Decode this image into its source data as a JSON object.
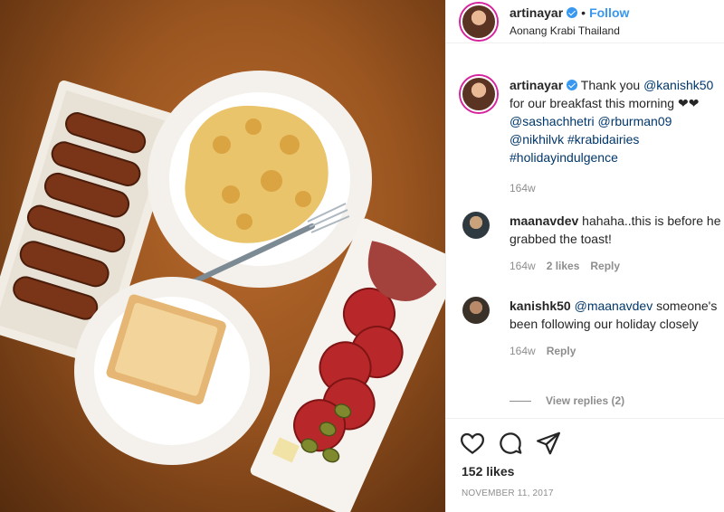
{
  "post_header": {
    "username": "artinayar",
    "follow_label": "Follow",
    "separator": "•",
    "location": "Aonang Krabi Thailand"
  },
  "caption": {
    "username": "artinayar",
    "text_before": "Thank you",
    "mention_1": "@kanishk50",
    "text_after": "for our breakfast this morning ❤❤",
    "mentions": [
      "@sashachhetri",
      "@rburman09",
      "@nikhilvk"
    ],
    "hashtags": [
      "#krabidairies",
      "#holidayindulgence"
    ],
    "time": "164w"
  },
  "comments": [
    {
      "username": "maanavdev",
      "text": "hahaha..this is before he grabbed the toast!",
      "time": "164w",
      "likes": "2 likes",
      "reply_label": "Reply"
    },
    {
      "username": "kanishk50",
      "mention": "@maanavdev",
      "text": "someone's been following our holiday closely",
      "time": "164w",
      "reply_label": "Reply",
      "view_replies": "View replies (2)"
    }
  ],
  "actions": {
    "icons": [
      "heart-icon",
      "comment-icon",
      "share-icon"
    ],
    "likes": "152 likes",
    "date": "NOVEMBER 11, 2017"
  },
  "colors": {
    "link_blue": "#3897f0",
    "mention_blue": "#00376b",
    "secondary_text": "#8e8e8e",
    "table_wood": "#9a5520"
  }
}
